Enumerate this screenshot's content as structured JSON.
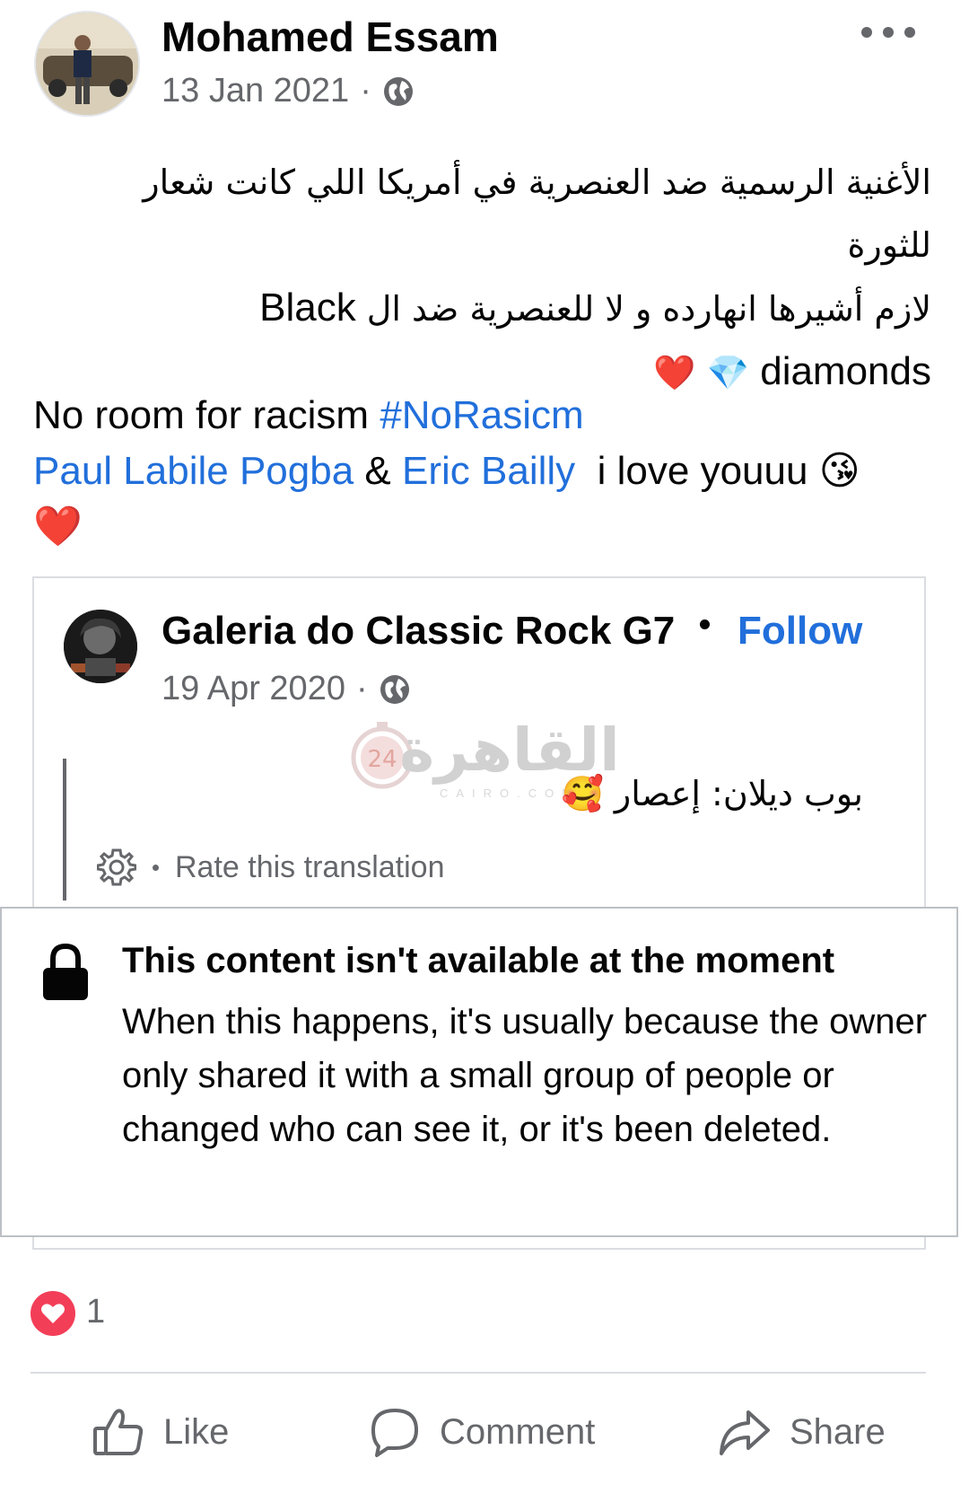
{
  "post": {
    "author_name": "Mohamed Essam",
    "date": "13 Jan 2021",
    "date_separator": "·",
    "body_rtl_line1": "الأغنية الرسمية ضد العنصرية في أمريكا اللي كانت شعار",
    "body_rtl_line2": "للثورة",
    "body_rtl_line3_ar": "لازم أشيرها انهارده و لا للعنصرية ضد ال",
    "body_rtl_line3_en": "Black",
    "body_line4_text": "diamonds",
    "body_line4_emoji_diamond": "💎",
    "body_line4_emoji_heart": "❤️",
    "body_line5_text": "No room for racism",
    "body_line5_hashtag": "#NoRasicm",
    "mention1": "Paul Labile Pogba",
    "amp": "&",
    "mention2": "Eric Bailly",
    "love_text": "i love youuu",
    "love_emoji": "😘",
    "end_emoji": "❤️"
  },
  "shared": {
    "page_name": "Galeria do Classic Rock G7",
    "follow_label": "Follow",
    "date": "19 Apr 2020",
    "date_separator": "·",
    "translated_text": "بوب ديلان: إعصار",
    "translated_emoji": "🥰",
    "rate_label": "Rate this translation"
  },
  "watermark": {
    "text_ar": "القاهرة",
    "text_en": "CAIRO.COM",
    "badge": "24"
  },
  "unavailable": {
    "title": "This content isn't available at the moment",
    "description": "When this happens, it's usually because the owner only shared it with a small group of people or changed who can see it, or it's been deleted."
  },
  "reactions": {
    "count": "1"
  },
  "actions": {
    "like": "Like",
    "comment": "Comment",
    "share": "Share"
  },
  "colors": {
    "link": "#216fdb",
    "secondary_text": "#65676b",
    "love_reaction": "#f33e58"
  }
}
